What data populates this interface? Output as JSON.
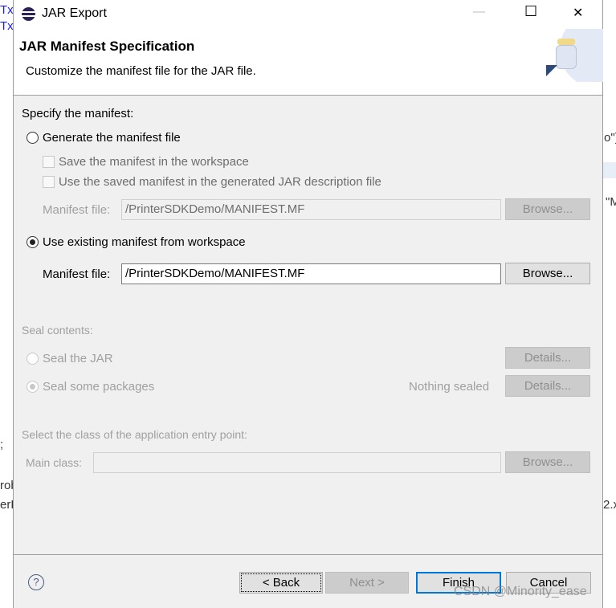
{
  "background_fragments": {
    "left1": "Tx",
    "left2": "Tx",
    "right1": "o\")",
    "right2": "\"M",
    "left3": ";",
    "left4": "rob",
    "left5": "erD",
    "right3": "2.x"
  },
  "window": {
    "title": "JAR Export",
    "minimize": "—",
    "maximize": "☐",
    "close": "✕"
  },
  "header": {
    "title": "JAR Manifest Specification",
    "description": "Customize the manifest file for the JAR file."
  },
  "manifest": {
    "section_label": "Specify the manifest:",
    "generate_label": "Generate the manifest file",
    "generate_selected": false,
    "save_label": "Save the manifest in the workspace",
    "use_saved_label": "Use the saved manifest in the generated JAR description file",
    "gen_file_label": "Manifest file:",
    "gen_file_value": "/PrinterSDKDemo/MANIFEST.MF",
    "browse_label": "Browse...",
    "existing_label": "Use existing manifest from workspace",
    "existing_selected": true,
    "file_label": "Manifest file:",
    "file_value": "/PrinterSDKDemo/MANIFEST.MF"
  },
  "seal": {
    "section_label": "Seal contents:",
    "seal_jar_label": "Seal the JAR",
    "seal_packages_label": "Seal some packages",
    "nothing_sealed": "Nothing sealed",
    "details_label": "Details..."
  },
  "entry": {
    "section_label": "Select the class of the application entry point:",
    "main_class_label": "Main class:",
    "main_class_value": "",
    "browse_label": "Browse..."
  },
  "footer": {
    "help": "?",
    "back": "< Back",
    "next": "Next >",
    "finish": "Finish",
    "cancel": "Cancel"
  },
  "watermark": "CSDN @Minority_ease"
}
